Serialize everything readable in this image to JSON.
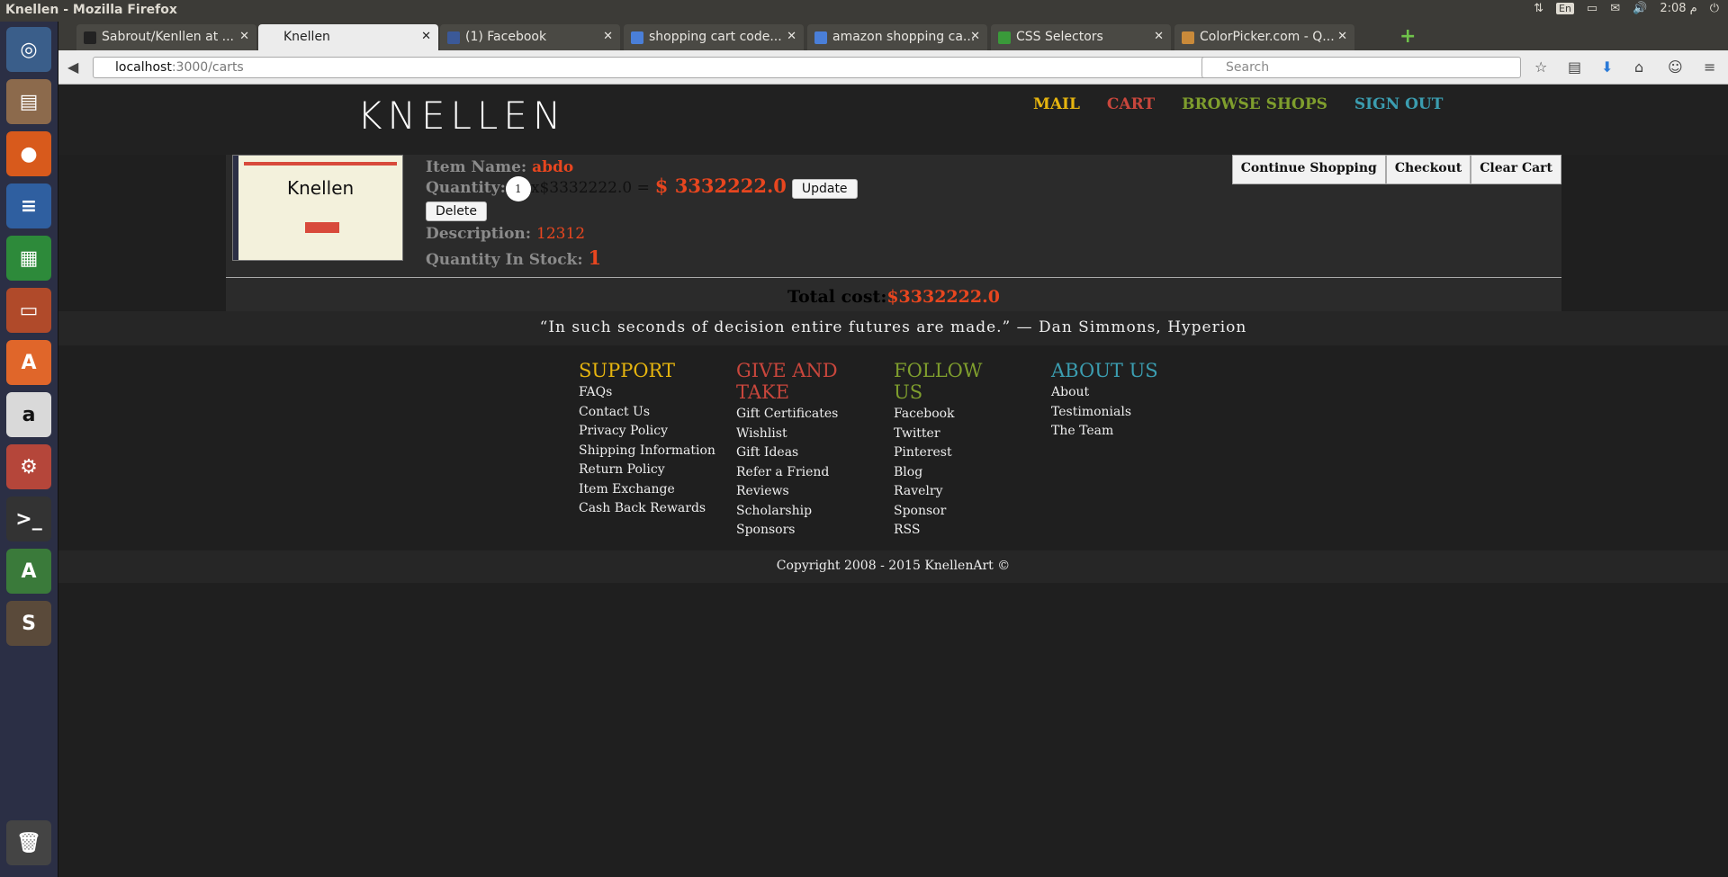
{
  "system": {
    "window_title": "Knellen - Mozilla Firefox",
    "keyboard": "En",
    "clock": "2:08 م"
  },
  "browser": {
    "tabs": [
      {
        "label": "Sabrout/Kenllen at ..."
      },
      {
        "label": "Knellen"
      },
      {
        "label": "(1) Facebook"
      },
      {
        "label": "shopping cart code..."
      },
      {
        "label": "amazon shopping ca..."
      },
      {
        "label": "CSS Selectors"
      },
      {
        "label": "ColorPicker.com - Q..."
      }
    ],
    "url_host": "localhost",
    "url_path": ":3000/carts",
    "search_placeholder": "Search"
  },
  "site": {
    "logo": "KNELLEN",
    "nav": [
      {
        "label": "MAIL",
        "color": "#e5b40f"
      },
      {
        "label": "CART",
        "color": "#c8463c"
      },
      {
        "label": "BROWSE SHOPS",
        "color": "#7f9e2d"
      },
      {
        "label": "SIGN OUT",
        "color": "#3b9db0"
      }
    ]
  },
  "cart": {
    "thumb_title": "Knellen",
    "item_name_label": "Item Name:",
    "item_name": "abdo",
    "quantity_label": "Quantity:",
    "quantity": "1",
    "unit_price": "x$3332222.0 =",
    "line_total": "$ 3332222.0",
    "update_label": "Update",
    "delete_label": "Delete",
    "description_label": "Description:",
    "description": "12312",
    "stock_label": "Quantity In Stock:",
    "stock": "1",
    "actions": [
      "Continue Shopping",
      "Checkout",
      "Clear Cart"
    ],
    "total_label": "Total cost:",
    "total": "$3332222.0"
  },
  "quote": "“In such seconds of decision entire futures are made.” — Dan Simmons, Hyperion",
  "footer": {
    "columns": [
      {
        "title": "SUPPORT",
        "color": "#e5b40f",
        "links": [
          "FAQs",
          "Contact Us",
          "Privacy Policy",
          "Shipping Information",
          "Return Policy",
          "Item Exchange",
          "Cash Back Rewards"
        ]
      },
      {
        "title": "GIVE AND TAKE",
        "color": "#c8463c",
        "links": [
          "Gift Certificates",
          "Wishlist",
          "Gift Ideas",
          "Refer a Friend",
          "Reviews",
          "Scholarship",
          "Sponsors"
        ]
      },
      {
        "title": "FOLLOW US",
        "color": "#7f9e2d",
        "links": [
          "Facebook",
          "Twitter",
          "Pinterest",
          "Blog",
          "Ravelry",
          "Sponsor",
          "RSS"
        ]
      },
      {
        "title": "ABOUT US",
        "color": "#3b9db0",
        "links": [
          "About",
          "Testimonials",
          "The Team"
        ]
      }
    ],
    "copyright": "Copyright 2008 - 2015 KnellenArt ©"
  },
  "launcher_icons": [
    "ubuntu-icon",
    "files-icon",
    "firefox-icon",
    "writer-icon",
    "calc-icon",
    "impress-icon",
    "software-center-icon",
    "amazon-icon",
    "settings-icon",
    "terminal-icon",
    "updater-icon",
    "sublime-icon",
    "trash-icon"
  ]
}
